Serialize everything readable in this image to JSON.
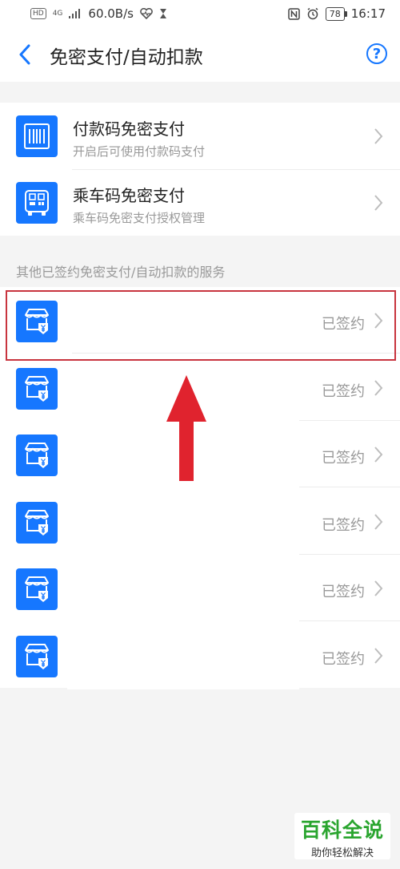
{
  "status_bar": {
    "hd": "HD",
    "network": "4G",
    "speed": "60.0B/s",
    "battery": "78",
    "time": "16:17"
  },
  "header": {
    "title": "免密支付/自动扣款",
    "help": "?"
  },
  "features": [
    {
      "title": "付款码免密支付",
      "subtitle": "开启后可使用付款码支付"
    },
    {
      "title": "乘车码免密支付",
      "subtitle": "乘车码免密支付授权管理"
    }
  ],
  "section_label": "其他已签约免密支付/自动扣款的服务",
  "services": [
    {
      "status": "已签约"
    },
    {
      "status": "已签约"
    },
    {
      "status": "已签约"
    },
    {
      "status": "已签约"
    },
    {
      "status": "已签约"
    },
    {
      "status": "已签约"
    }
  ],
  "watermark": {
    "main": "百科全说",
    "sub": "助你轻松解决"
  },
  "colors": {
    "accent": "#1677ff",
    "highlight": "#c8343e",
    "arrow": "#e0232e",
    "watermark": "#2aa52f"
  }
}
